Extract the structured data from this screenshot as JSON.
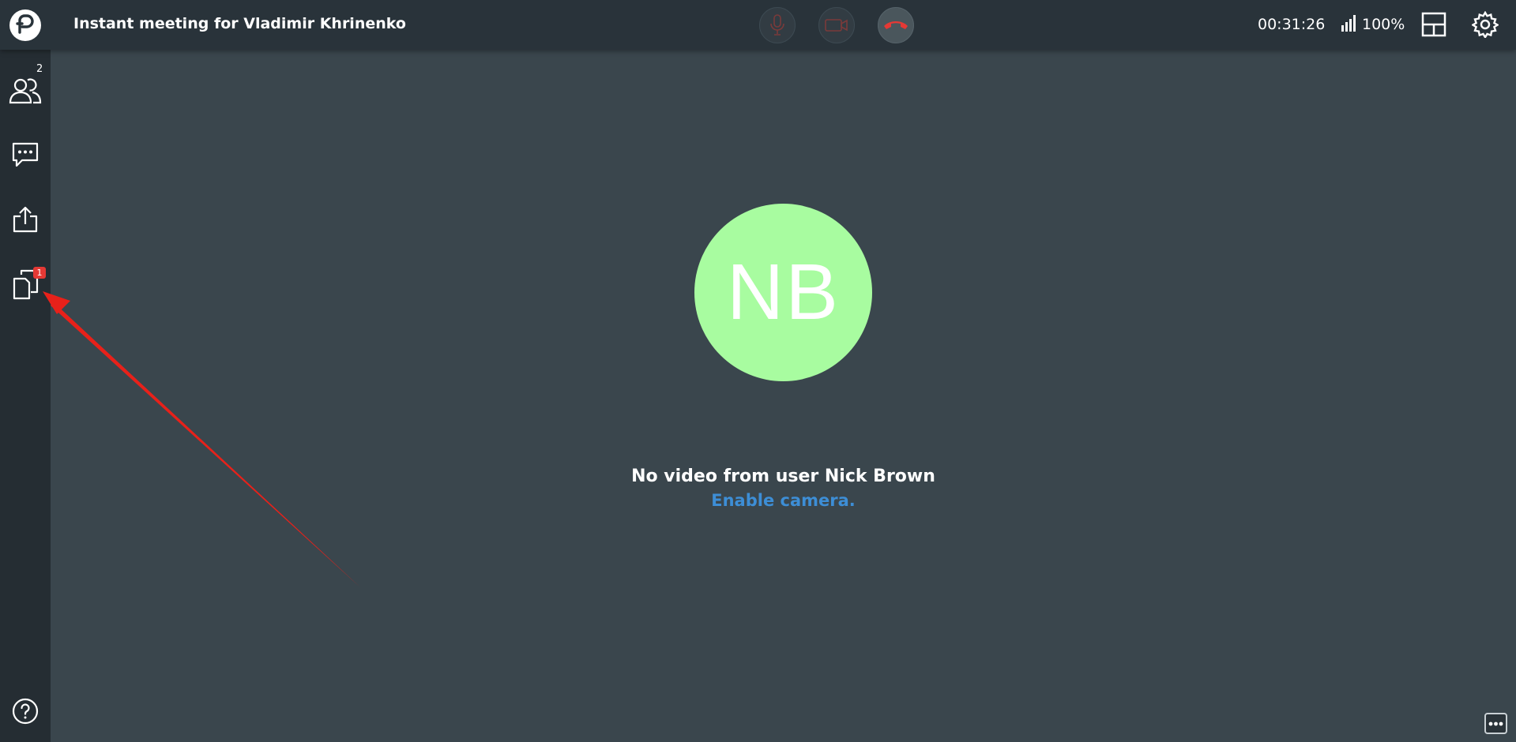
{
  "header": {
    "title": "Instant meeting for Vladimir Khrinenko",
    "timer": "00:31:26",
    "quality": "100%"
  },
  "controls": {
    "mic_icon": "microphone-icon",
    "camera_icon": "video-camera-icon",
    "hangup_icon": "phone-hangup-icon",
    "hangup_color": "#e53935"
  },
  "sidebar": {
    "participants_count": "2",
    "files_badge": "1",
    "items": [
      "participants-icon",
      "chat-icon",
      "share-icon",
      "files-icon",
      "help-icon"
    ]
  },
  "main": {
    "avatar_initials": "NB",
    "avatar_color": "#a8fca0",
    "no_video_text": "No video from user Nick Brown",
    "enable_camera_text": "Enable camera."
  },
  "annotation": {
    "arrow_color": "#e8211a"
  }
}
